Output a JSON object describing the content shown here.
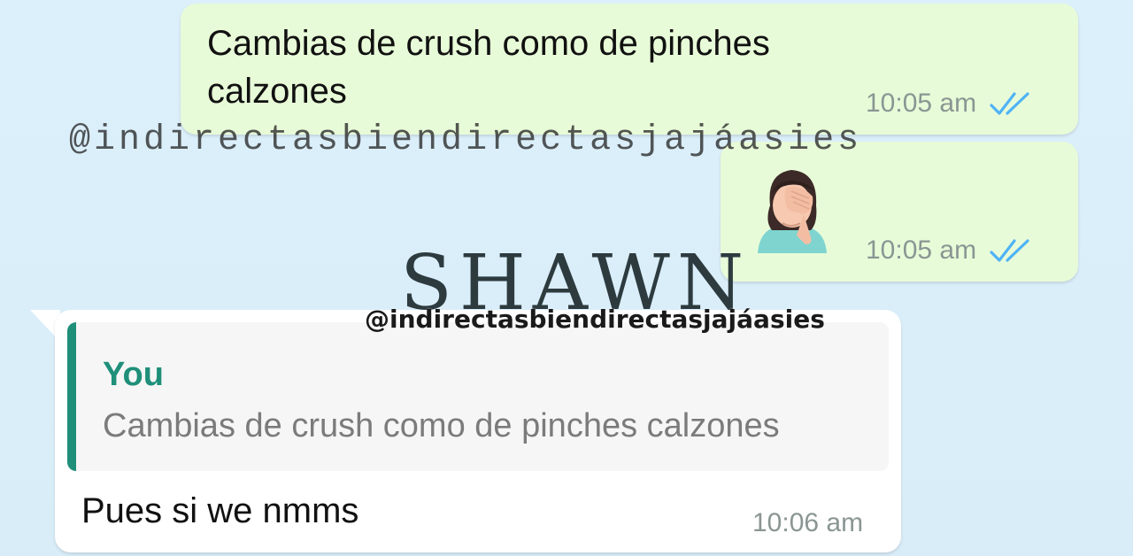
{
  "watermarks": {
    "handle_mono": "@indirectasbiendirectasjajáasies",
    "brand": "SHAWN",
    "handle_bold": "@indirectasbiendirectasjajáasies"
  },
  "messages": [
    {
      "direction": "outgoing",
      "text": "Cambias de crush como de pinches calzones",
      "time": "10:05 am",
      "status_icon": "double-check-icon"
    },
    {
      "direction": "outgoing",
      "emoji": "woman-facepalming",
      "time": "10:05 am",
      "status_icon": "double-check-icon"
    },
    {
      "direction": "incoming",
      "quoted": {
        "author": "You",
        "text": "Cambias de crush como de pinches calzones"
      },
      "text": "Pues si we nmms",
      "time": "10:06 am"
    }
  ],
  "colors": {
    "background": "#dbeefb",
    "outgoing_bubble": "#e8fbd8",
    "incoming_bubble": "#ffffff",
    "quote_accent": "#1f8f7a",
    "read_ticks": "#4fb3f6"
  }
}
